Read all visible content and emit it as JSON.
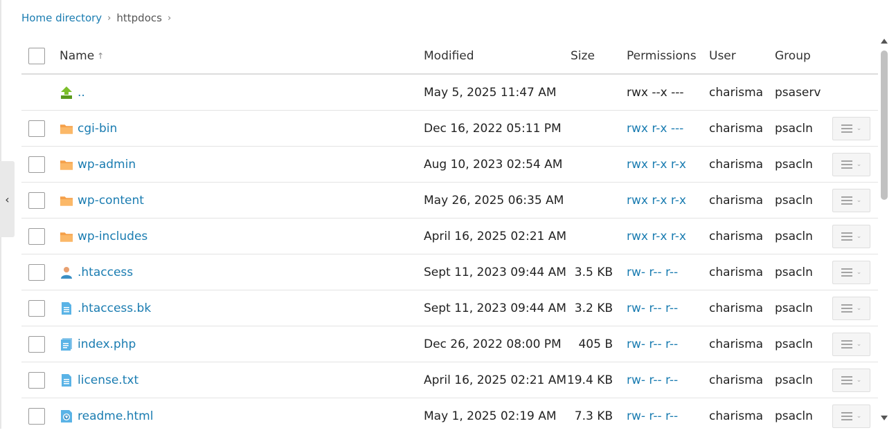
{
  "breadcrumb": {
    "home": "Home directory",
    "sep": "›",
    "current": "httpdocs"
  },
  "collapse_glyph": "‹",
  "columns": {
    "name": "Name",
    "sort": "↑",
    "modified": "Modified",
    "size": "Size",
    "permissions": "Permissions",
    "user": "User",
    "group": "Group"
  },
  "rows": [
    {
      "name": "..",
      "icon": "parent-dir-icon",
      "modified": "May 5, 2025 11:47 AM",
      "size": "",
      "permissions": "rwx --x ---",
      "user": "charisma",
      "group": "psaserv"
    },
    {
      "name": "cgi-bin",
      "icon": "folder-icon",
      "modified": "Dec 16, 2022 05:11 PM",
      "size": "",
      "permissions": "rwx r-x ---",
      "user": "charisma",
      "group": "psacln"
    },
    {
      "name": "wp-admin",
      "icon": "folder-icon",
      "modified": "Aug 10, 2023 02:54 AM",
      "size": "",
      "permissions": "rwx r-x r-x",
      "user": "charisma",
      "group": "psacln"
    },
    {
      "name": "wp-content",
      "icon": "folder-icon",
      "modified": "May 26, 2025 06:35 AM",
      "size": "",
      "permissions": "rwx r-x r-x",
      "user": "charisma",
      "group": "psacln"
    },
    {
      "name": "wp-includes",
      "icon": "folder-icon",
      "modified": "April 16, 2025 02:21 AM",
      "size": "",
      "permissions": "rwx r-x r-x",
      "user": "charisma",
      "group": "psacln"
    },
    {
      "name": ".htaccess",
      "icon": "user-file-icon",
      "modified": "Sept 11, 2023 09:44 AM",
      "size": "3.5 KB",
      "permissions": "rw- r-- r--",
      "user": "charisma",
      "group": "psacln"
    },
    {
      "name": ".htaccess.bk",
      "icon": "text-file-icon",
      "modified": "Sept 11, 2023 09:44 AM",
      "size": "3.2 KB",
      "permissions": "rw- r-- r--",
      "user": "charisma",
      "group": "psacln"
    },
    {
      "name": "index.php",
      "icon": "script-file-icon",
      "modified": "Dec 26, 2022 08:00 PM",
      "size": "405 B",
      "permissions": "rw- r-- r--",
      "user": "charisma",
      "group": "psacln"
    },
    {
      "name": "license.txt",
      "icon": "text-file-icon",
      "modified": "April 16, 2025 02:21 AM",
      "size": "19.4 KB",
      "permissions": "rw- r-- r--",
      "user": "charisma",
      "group": "psacln"
    },
    {
      "name": "readme.html",
      "icon": "html-file-icon",
      "modified": "May 1, 2025 02:19 AM",
      "size": "7.3 KB",
      "permissions": "rw- r-- r--",
      "user": "charisma",
      "group": "psacln"
    }
  ],
  "colors": {
    "link": "#1a7cb1",
    "folder": "#f5a04a",
    "file": "#5ab3e6",
    "parent_arrow": "#7cbf2a"
  }
}
